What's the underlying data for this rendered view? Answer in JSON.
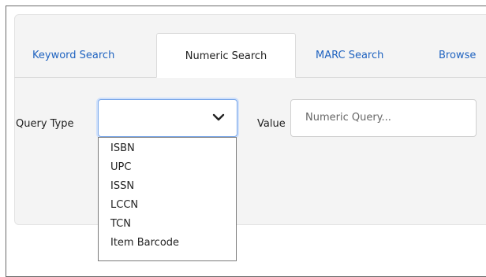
{
  "tabs": [
    {
      "label": "Keyword Search"
    },
    {
      "label": "Numeric Search"
    },
    {
      "label": "MARC Search"
    },
    {
      "label": "Browse"
    }
  ],
  "query": {
    "label": "Query Type",
    "selected_value": "",
    "options": [
      "ISBN",
      "UPC",
      "ISSN",
      "LCCN",
      "TCN",
      "Item Barcode"
    ]
  },
  "value_field": {
    "label": "Value",
    "placeholder": "Numeric Query..."
  },
  "colors": {
    "link_blue": "#1f63c0",
    "focus_border": "#7aa7e8",
    "panel_bg": "#f4f4f4"
  }
}
